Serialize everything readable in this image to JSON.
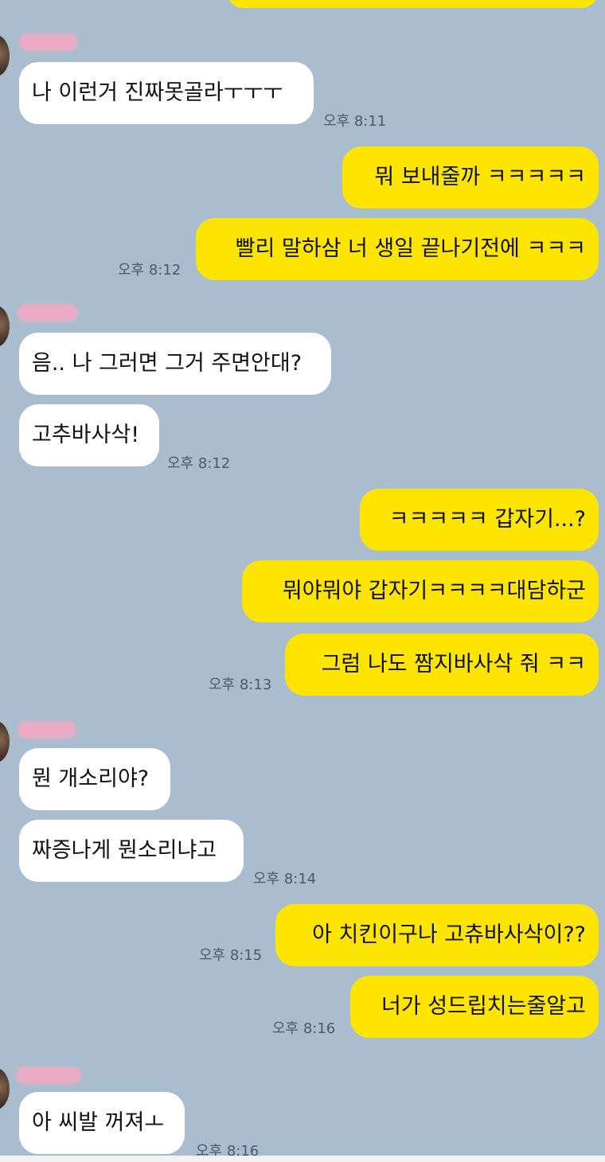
{
  "messages": [
    {
      "text": "나 이런거 진짜못골라ㅜㅜㅜ",
      "time": "오후 8:11"
    },
    {
      "text": "뭐 보내줄까 ㅋㅋㅋㅋㅋ"
    },
    {
      "text": "빨리 말하삼 너 생일 끝나기전에 ㅋㅋㅋ",
      "time": "오후 8:12"
    },
    {
      "text": "음.. 나 그러면 그거 주면안대?"
    },
    {
      "text": "고추바사삭!",
      "time": "오후 8:12"
    },
    {
      "text": "ㅋㅋㅋㅋㅋ 갑자기...?"
    },
    {
      "text": "뭐야뭐야 갑자기ㅋㅋㅋㅋ대담하군"
    },
    {
      "text": "그럼 나도 짬지바사삭 줘 ㅋㅋ",
      "time": "오후 8:13"
    },
    {
      "text": "뭔 개소리야?"
    },
    {
      "text": "짜증나게 뭔소리냐고",
      "time": "오후 8:14"
    },
    {
      "text": "아 치킨이구나 고츄바사삭이??",
      "time": "오후 8:15"
    },
    {
      "text": "너가 성드립치는줄알고",
      "time": "오후 8:16"
    },
    {
      "text": "아 씨발 꺼져ㅗ",
      "time": "오후 8:16"
    }
  ],
  "colors": {
    "background": "#a9bdce",
    "incoming_bubble": "#ffffff",
    "outgoing_bubble": "#fee500",
    "timestamp": "#4d5a66"
  }
}
